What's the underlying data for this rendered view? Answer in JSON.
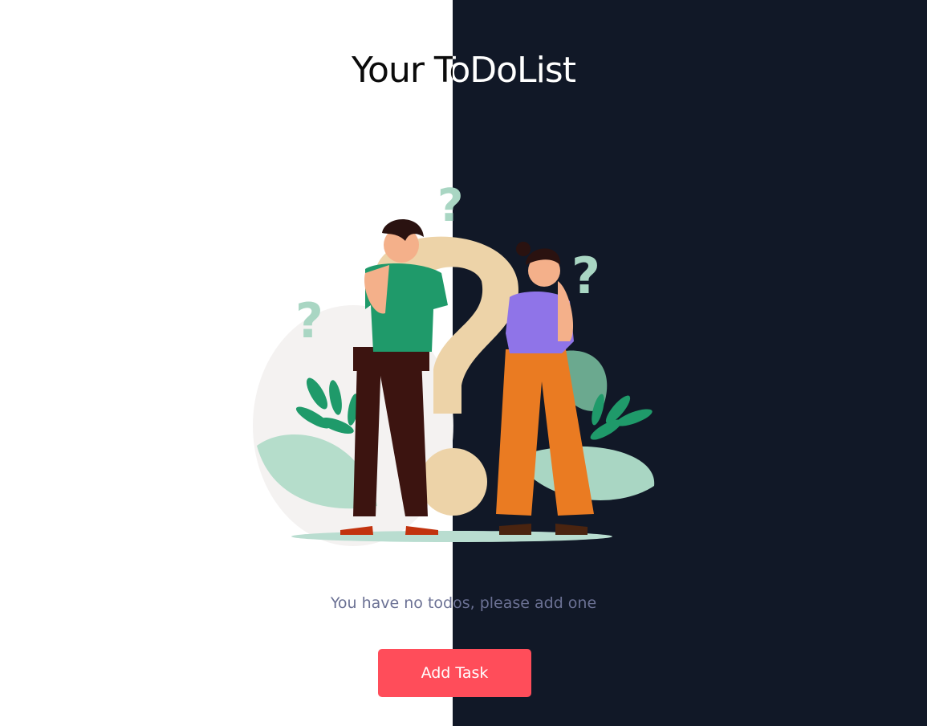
{
  "header": {
    "title": "Your ToDoList"
  },
  "empty_state": {
    "message": "You have no todos, please add one",
    "illustration": "two-people-thinking-question-marks"
  },
  "actions": {
    "add_task_label": "Add Task"
  },
  "colors": {
    "light_bg": "#ffffff",
    "dark_bg": "#111827",
    "accent": "#ff4d5a",
    "muted_text": "#6b7194"
  }
}
